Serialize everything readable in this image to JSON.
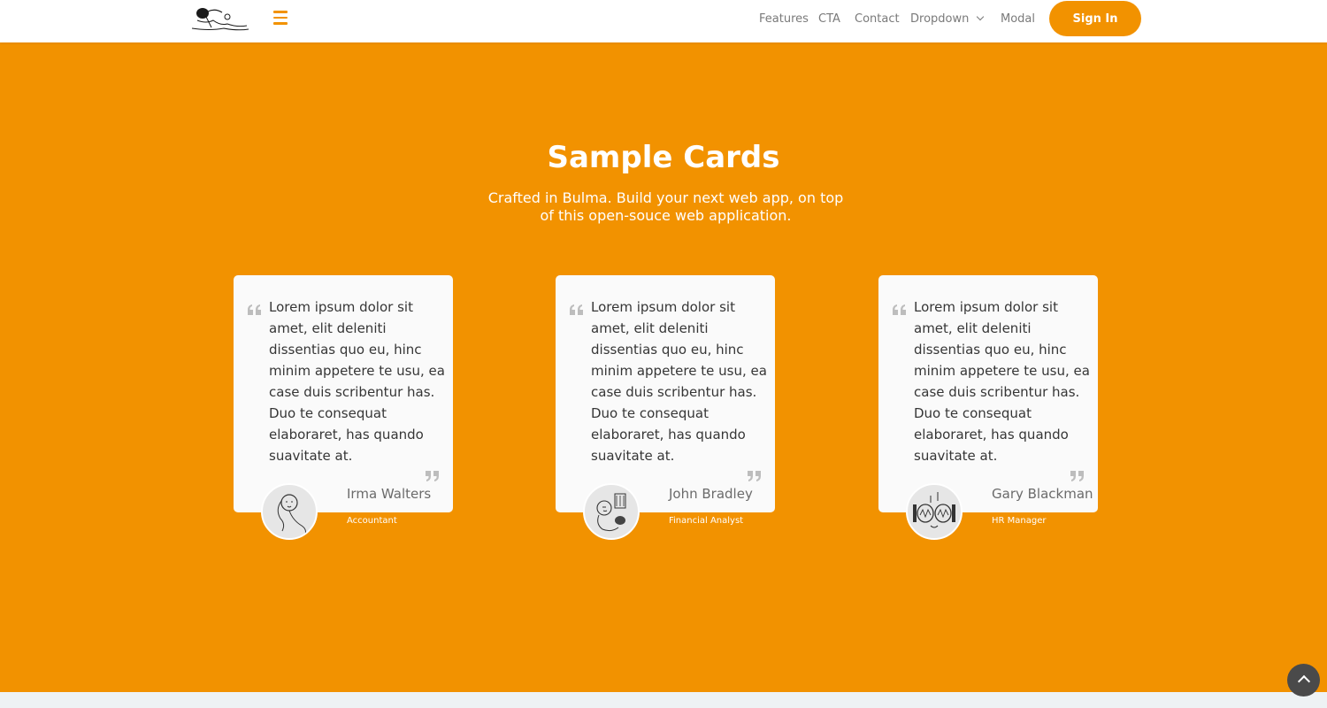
{
  "navbar": {
    "logo_name": "sketch-logo",
    "menu_icon": "hamburger-icon",
    "links": [
      "Features",
      "CTA",
      "Contact",
      "Dropdown",
      "Modal"
    ],
    "signin_label": "Sign In"
  },
  "hero": {
    "title": "Sample Cards",
    "subtitle": "Crafted in Bulma. Build your next web app, on top of this open-souce web application."
  },
  "cards": [
    {
      "quote": "Lorem ipsum dolor sit amet, elit deleniti dissentias quo eu, hinc minim appetere te usu, ea case duis scribentur has. Duo te consequat elaboraret, has quando suavitate at.",
      "author": "Irma Walters",
      "role": "Accountant"
    },
    {
      "quote": "Lorem ipsum dolor sit amet, elit deleniti dissentias quo eu, hinc minim appetere te usu, ea case duis scribentur has. Duo te consequat elaboraret, has quando suavitate at.",
      "author": "John Bradley",
      "role": "Financial Analyst"
    },
    {
      "quote": "Lorem ipsum dolor sit amet, elit deleniti dissentias quo eu, hinc minim appetere te usu, ea case duis scribentur has. Duo te consequat elaboraret, has quando suavitate at.",
      "author": "Gary Blackman",
      "role": "HR Manager"
    }
  ],
  "colors": {
    "accent": "#f29200",
    "card_bg": "#fafafa",
    "text_dark": "#363636",
    "nav_text": "#7a7a7a",
    "back_to_top": "#4a4a4a"
  },
  "icons": {
    "open_quote": "quote-left-icon",
    "close_quote": "quote-right-icon",
    "back_to_top": "chevron-up-icon"
  }
}
